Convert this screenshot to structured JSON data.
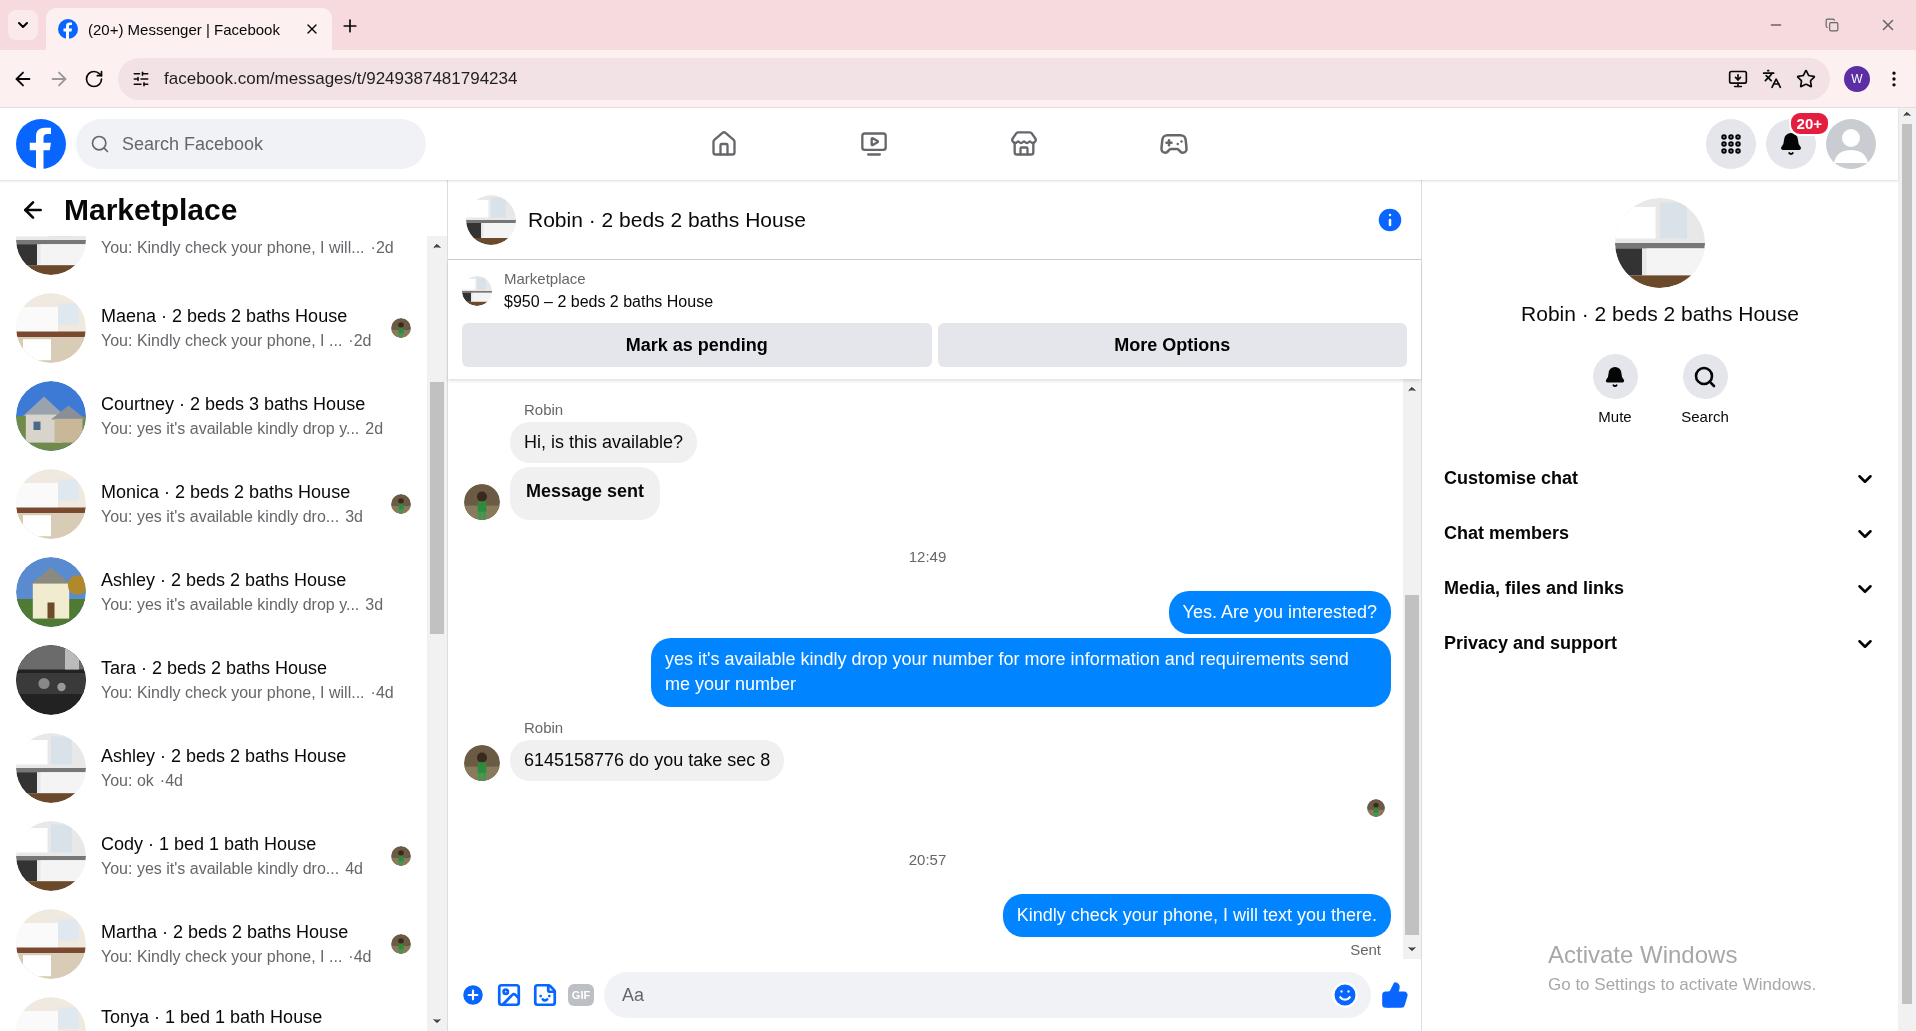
{
  "browser": {
    "tab_title": "(20+) Messenger | Facebook",
    "url": "facebook.com/messages/t/9249387481794234",
    "profile_initial": "W"
  },
  "header": {
    "search_placeholder": "Search Facebook",
    "notification_badge": "20+"
  },
  "sidebar": {
    "title": "Marketplace",
    "conversations": [
      {
        "preview": "You: Kindly check your phone, I will...",
        "time": "·2d",
        "seen": false
      },
      {
        "title": "Maena · 2 beds 2 baths House",
        "preview": "You: Kindly check your phone, I ...",
        "time": "·2d",
        "seen": true
      },
      {
        "title": "Courtney · 2 beds 3 baths House",
        "preview": "You: yes it's available kindly drop y...",
        "time": "2d",
        "seen": false
      },
      {
        "title": "Monica · 2 beds 2 baths House",
        "preview": "You: yes it's available kindly dro...",
        "time": "3d",
        "seen": true
      },
      {
        "title": "Ashley · 2 beds 2 baths House",
        "preview": "You: yes it's available kindly drop y...",
        "time": "3d",
        "seen": false
      },
      {
        "title": "Tara · 2 beds 2 baths House",
        "preview": "You: Kindly check your phone, I will...",
        "time": "·4d",
        "seen": false
      },
      {
        "title": "Ashley · 2 beds 2 baths House",
        "preview": "You: ok",
        "time": "·4d",
        "seen": false
      },
      {
        "title": "Cody · 1 bed 1 bath House",
        "preview": "You: yes it's available kindly dro...",
        "time": "4d",
        "seen": true
      },
      {
        "title": "Martha · 2 beds 2 baths House",
        "preview": "You: Kindly check your phone, I ...",
        "time": "·4d",
        "seen": true
      },
      {
        "title": "Tonya · 1 bed 1 bath House"
      }
    ]
  },
  "chat": {
    "title": "Robin · 2 beds 2 baths House",
    "listing_label": "Marketplace",
    "listing_title": "$950 – 2 beds 2 baths House",
    "actions": [
      "Mark as pending",
      "More Options"
    ],
    "messages": [
      {
        "kind": "sender",
        "text": "Robin"
      },
      {
        "kind": "in",
        "text": "Hi, is this available?",
        "bold": false,
        "avatar": false
      },
      {
        "kind": "in",
        "text": "Message sent",
        "bold": true,
        "avatar": true
      },
      {
        "kind": "time",
        "text": "12:49"
      },
      {
        "kind": "out",
        "text": "Yes. Are you interested?"
      },
      {
        "kind": "out",
        "text": "yes it's available kindly drop your number for more information and requirements send me your number"
      },
      {
        "kind": "sender",
        "text": "Robin"
      },
      {
        "kind": "in",
        "text": "6145158776 do you take sec 8",
        "bold": false,
        "avatar": true
      },
      {
        "kind": "seen"
      },
      {
        "kind": "time",
        "text": "20:57"
      },
      {
        "kind": "out",
        "text": "Kindly check your phone, I will text you there."
      },
      {
        "kind": "status",
        "text": "Sent"
      }
    ],
    "composer": {
      "gif_label": "GIF",
      "placeholder": "Aa"
    }
  },
  "details": {
    "title": "Robin · 2 beds 2 baths House",
    "actions": [
      {
        "kind": "bell",
        "label": "Mute"
      },
      {
        "kind": "search",
        "label": "Search"
      }
    ],
    "sections": [
      {
        "label": "Customise chat",
        "expanded": false
      },
      {
        "label": "Chat members",
        "expanded": false
      },
      {
        "label": "Media, files and links",
        "expanded": false
      },
      {
        "label": "Privacy and support",
        "expanded": false
      }
    ]
  },
  "os_notice": {
    "title": "Activate Windows",
    "subtitle": "Go to Settings to activate Windows."
  }
}
